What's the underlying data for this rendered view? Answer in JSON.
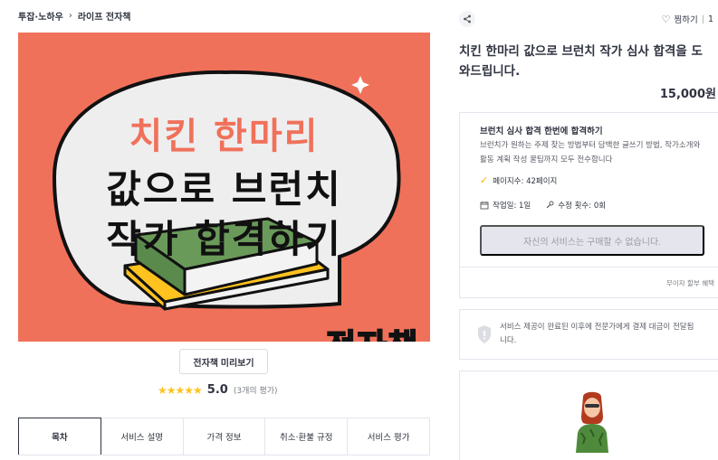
{
  "breadcrumb": [
    "투잡·노하우",
    "라이프 전자책"
  ],
  "hero": {
    "line1": "치킨 한마리",
    "line2": "값으로 브런치",
    "line3": "작가 합격하기",
    "badge": "전자책",
    "background_color": "#f0715a"
  },
  "preview_button": "전자책 미리보기",
  "rating": {
    "stars": "★★★★★",
    "score": "5.0",
    "count": "(3개의 평가)"
  },
  "tabs": [
    "목차",
    "서비스 설명",
    "가격 정보",
    "취소·환불 규정",
    "서비스 평가"
  ],
  "actions": {
    "like_label": "찜하기",
    "like_count": "1"
  },
  "product": {
    "title": "치킨 한마리 값으로 브런치 작가 심사 합격을 도와드립니다.",
    "price": "15,000원"
  },
  "package": {
    "title": "브런치 심사 합격 한번에 합격하기",
    "description": "브런치가 원하는 주제 찾는 방법부터 담백한 글쓰기 방법, 작가소개와 활동 계획 작성 꿀팁까지 모두 전수합니다",
    "pages": "페이지수: 42페이지",
    "work_days": "작업일: 1일",
    "revisions": "수정 횟수: 0회",
    "buy_button": "자신의 서비스는 구매할 수 없습니다.",
    "benefit": "무이자 할부 혜택"
  },
  "notice": {
    "text": "서비스 제공이 완료된 이후에 전문가에게 결제 대금이 전달됩니다."
  }
}
